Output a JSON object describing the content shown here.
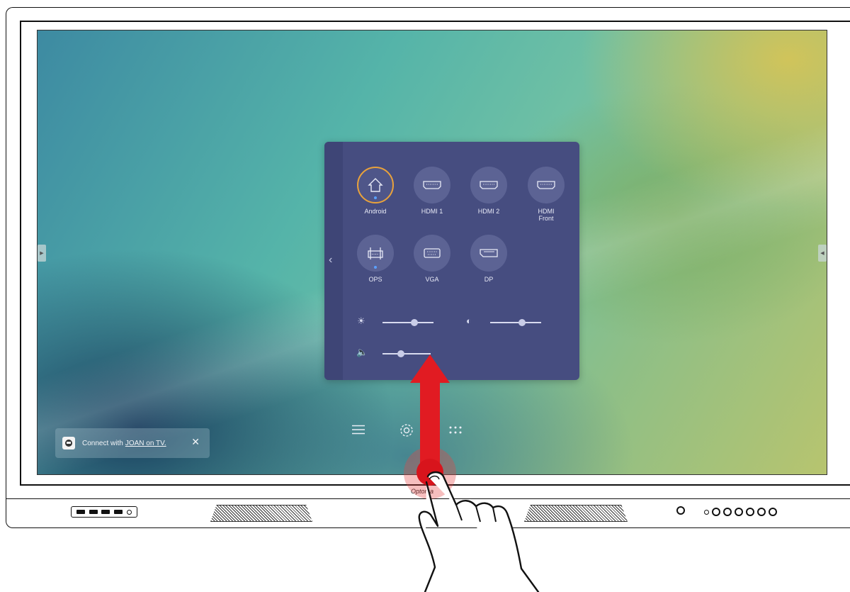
{
  "panel": {
    "sources": [
      {
        "label": "Android",
        "icon": "home-icon",
        "active": true
      },
      {
        "label": "HDMI 1",
        "icon": "hdmi-icon",
        "active": false
      },
      {
        "label": "HDMI 2",
        "icon": "hdmi-icon",
        "active": false
      },
      {
        "label": "HDMI",
        "label2": "Front",
        "icon": "hdmi-icon",
        "active": false
      },
      {
        "label": "OPS",
        "icon": "ops-icon",
        "active": false
      },
      {
        "label": "VGA",
        "icon": "vga-icon",
        "active": false
      },
      {
        "label": "DP",
        "icon": "displayport-icon",
        "active": false
      }
    ],
    "sliders": {
      "brightness": 0.63,
      "contrast": 0.63,
      "volume": 0.38
    }
  },
  "toast": {
    "text": "Connect with",
    "link": "JOAN on TV.",
    "close": "✕"
  },
  "brand": "Optoma",
  "colors": {
    "panel": "#464d80",
    "active_ring": "#e9a23b",
    "arrow": "#e11b22"
  }
}
